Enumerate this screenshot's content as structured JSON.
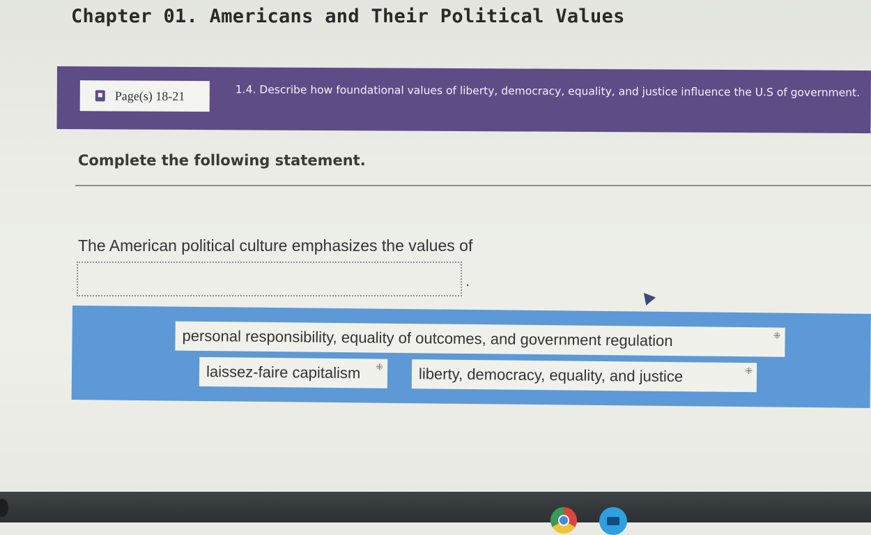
{
  "header": {
    "chapter_title": "Chapter 01. Americans and Their Political Values"
  },
  "objective": {
    "page_reference": "Page(s) 18-21",
    "text": "1.4. Describe how foundational values of liberty, democracy, equality, and justice influence the U.S of government."
  },
  "question": {
    "instruction": "Complete the following statement.",
    "statement": "The American political culture emphasizes the values of",
    "blank_suffix": "."
  },
  "choices": [
    {
      "label": "personal responsibility, equality of outcomes, and government regulation"
    },
    {
      "label": "laissez-faire capitalism"
    },
    {
      "label": "liberty, democracy, equality, and justice"
    }
  ],
  "icons": {
    "drag_handle": "⁜"
  },
  "colors": {
    "objective_banner": "#5e4c86",
    "choices_panel": "#5d99d6",
    "choice_background": "#f1f1ec"
  }
}
